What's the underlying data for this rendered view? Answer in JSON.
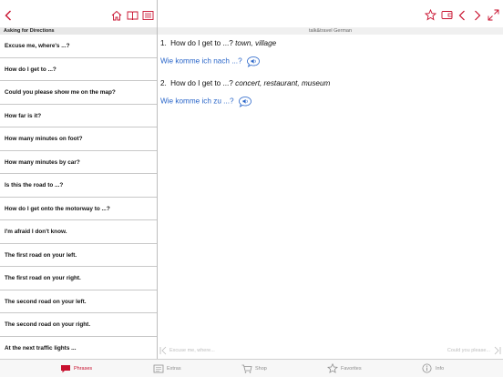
{
  "colors": {
    "accent": "#c8102e",
    "link": "#2a66c9"
  },
  "left": {
    "section_title": "Asking for Directions",
    "items": [
      "Excuse me, where's ...?",
      "How do I get to ...?",
      "Could you please show me on the map?",
      "How far is it?",
      "How many minutes on foot?",
      "How many minutes by car?",
      "Is this the road to ...?",
      "How do I get onto the motorway to ...?",
      "I'm afraid I don't know.",
      "The first road on your left.",
      "The first road on your right.",
      "The second road on your left.",
      "The second road on your right.",
      "At the next traffic lights ..."
    ]
  },
  "right": {
    "title": "talk&travel German",
    "phrases": [
      {
        "num": "1.",
        "text": "How do I get to ...?",
        "hint": "town, village",
        "translation": "Wie komme ich nach ...?"
      },
      {
        "num": "2.",
        "text": "How do I get to ...?",
        "hint": "concert, restaurant, museum",
        "translation": "Wie komme ich zu ...?"
      }
    ],
    "prev_label": "Excuse me, where...",
    "next_label": "Could you please..."
  },
  "tabs": [
    {
      "label": "Phrases",
      "icon": "phrases-icon"
    },
    {
      "label": "Extras",
      "icon": "extras-icon"
    },
    {
      "label": "Shop",
      "icon": "cart-icon"
    },
    {
      "label": "Favorites",
      "icon": "star-icon"
    },
    {
      "label": "Info",
      "icon": "info-icon"
    }
  ]
}
